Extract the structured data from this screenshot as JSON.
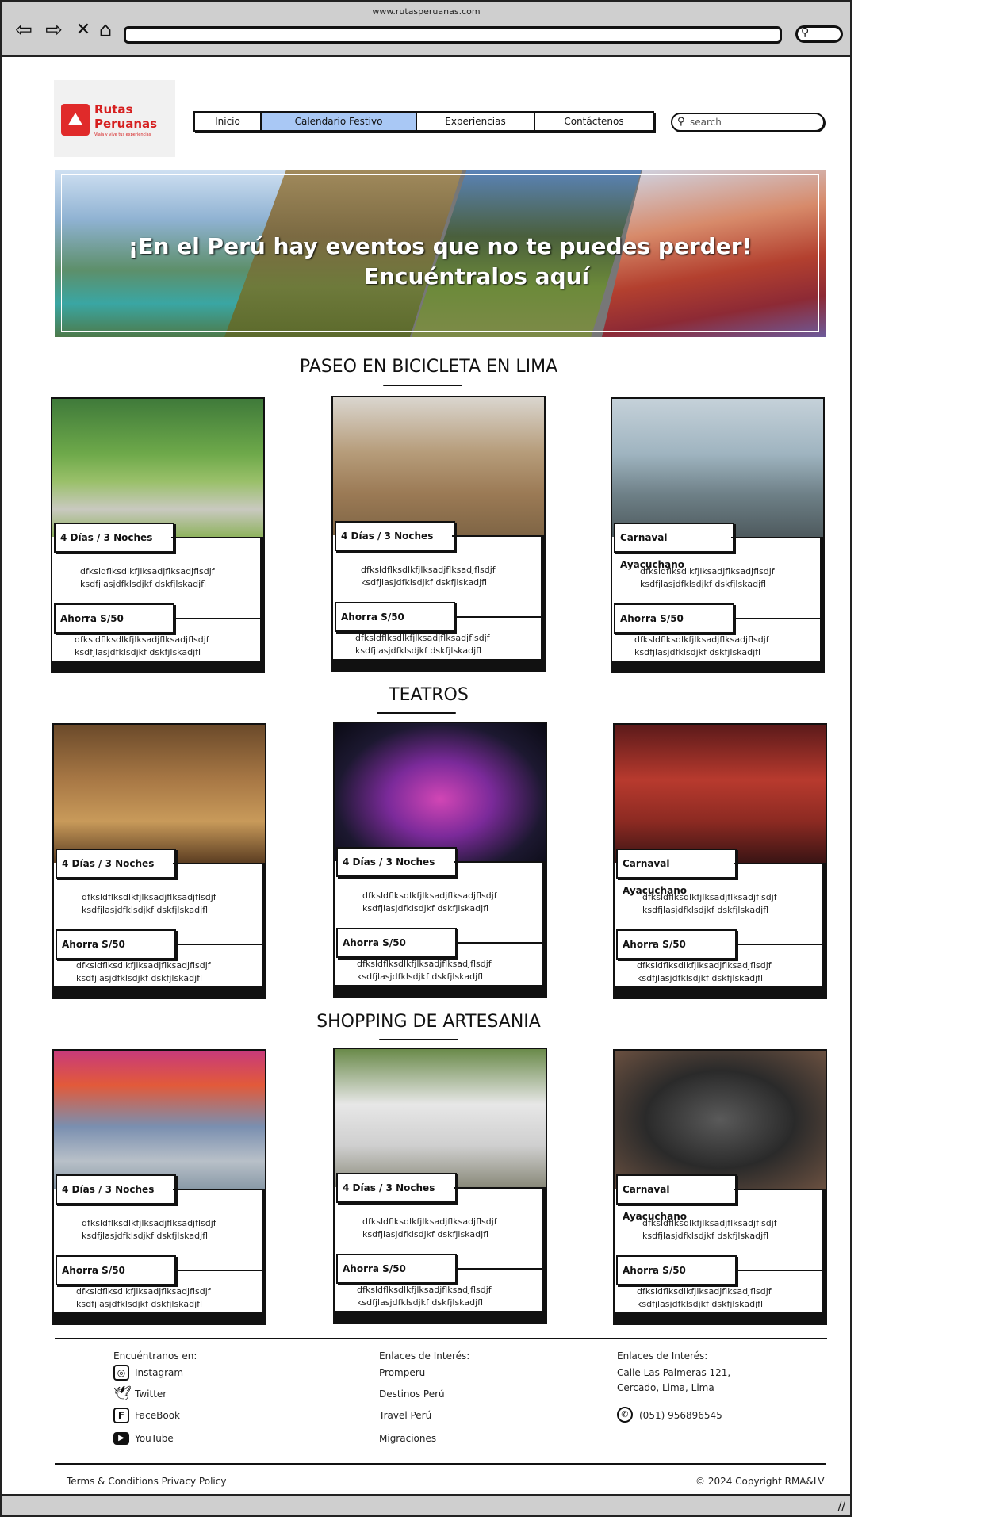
{
  "browser": {
    "url": "www.rutasperuanas.com"
  },
  "logo": {
    "name_line1": "Rutas",
    "name_line2": "Peruanas",
    "tagline": "Viaja y vive tus experiencias"
  },
  "menu": {
    "items": [
      "Inicio",
      "Calendario Festivo",
      "Experiencias",
      "Contáctenos"
    ],
    "active": "Calendario Festivo"
  },
  "search": {
    "placeholder": "search"
  },
  "banner": {
    "line1": "¡En el Perú hay eventos que no te puedes perder!",
    "line2": "Encuéntralos aquí"
  },
  "sections": [
    {
      "title": "PASEO EN BICICLETA EN LIMA",
      "cards": [
        {
          "tag": "4 Días / 3 Noches",
          "desc": "dfksldflksdlkfjlksadjflksadjflsdjf ksdfjlasjdfklsdjkf dskfjlskadjfl",
          "price": "Ahorra S/50",
          "desc2": "dfksldflksdlkfjlksadjflksadjflsdjf ksdfjlasjdfklsdjkf dskfjlskadjfl"
        },
        {
          "tag": "4 Días / 3 Noches",
          "desc": "dfksldflksdlkfjlksadjflksadjflsdjf ksdfjlasjdfklsdjkf dskfjlskadjfl",
          "price": "Ahorra S/50",
          "desc2": "dfksldflksdlkfjlksadjflksadjflsdjf ksdfjlasjdfklsdjkf dskfjlskadjfl"
        },
        {
          "tag": "Carnaval Ayacuchano",
          "desc": "dfksldflksdlkfjlksadjflksadjflsdjf ksdfjlasjdfklsdjkf dskfjlskadjfl",
          "price": "Ahorra S/50",
          "desc2": "dfksldflksdlkfjlksadjflksadjflsdjf ksdfjlasjdfklsdjkf dskfjlskadjfl"
        }
      ]
    },
    {
      "title": "TEATROS",
      "cards": [
        {
          "tag": "4 Días / 3 Noches",
          "desc": "dfksldflksdlkfjlksadjflksadjflsdjf ksdfjlasjdfklsdjkf dskfjlskadjfl",
          "price": "Ahorra S/50",
          "desc2": "dfksldflksdlkfjlksadjflksadjflsdjf ksdfjlasjdfklsdjkf dskfjlskadjfl"
        },
        {
          "tag": "4 Días / 3 Noches",
          "desc": "dfksldflksdlkfjlksadjflksadjflsdjf ksdfjlasjdfklsdjkf dskfjlskadjfl",
          "price": "Ahorra S/50",
          "desc2": "dfksldflksdlkfjlksadjflksadjflsdjf ksdfjlasjdfklsdjkf dskfjlskadjfl"
        },
        {
          "tag": "Carnaval Ayacuchano",
          "desc": "dfksldflksdlkfjlksadjflksadjflsdjf ksdfjlasjdfklsdjkf dskfjlskadjfl",
          "price": "Ahorra S/50",
          "desc2": "dfksldflksdlkfjlksadjflksadjflsdjf ksdfjlasjdfklsdjkf dskfjlskadjfl"
        }
      ]
    },
    {
      "title": "SHOPPING DE ARTESANIA",
      "cards": [
        {
          "tag": "4 Días / 3 Noches",
          "desc": "dfksldflksdlkfjlksadjflksadjflsdjf ksdfjlasjdfklsdjkf dskfjlskadjfl",
          "price": "Ahorra S/50",
          "desc2": "dfksldflksdlkfjlksadjflksadjflsdjf ksdfjlasjdfklsdjkf dskfjlskadjfl"
        },
        {
          "tag": "4 Días / 3 Noches",
          "desc": "dfksldflksdlkfjlksadjflksadjflsdjf ksdfjlasjdfklsdjkf dskfjlskadjfl",
          "price": "Ahorra S/50",
          "desc2": "dfksldflksdlkfjlksadjflksadjflsdjf ksdfjlasjdfklsdjkf dskfjlskadjfl"
        },
        {
          "tag": "Carnaval Ayacuchano",
          "desc": "dfksldflksdlkfjlksadjflksadjflsdjf ksdfjlasjdfklsdjkf dskfjlskadjfl",
          "price": "Ahorra S/50",
          "desc2": "dfksldflksdlkfjlksadjflksadjflsdjf ksdfjlasjdfklsdjkf dskfjlskadjfl"
        }
      ]
    }
  ],
  "footer": {
    "social_heading": "Encuéntranos en:",
    "social": [
      "Instagram",
      "Twitter",
      "FaceBook",
      "YouTube"
    ],
    "links_heading": "Enlaces de Interés:",
    "links": [
      "Promperu",
      "Destinos Perú",
      "Travel Perú",
      "Migraciones"
    ],
    "contact_heading": "Enlaces de Interés:",
    "address_line1": "Calle Las Palmeras 121,",
    "address_line2": "Cercado, Lima, Lima",
    "phone": "(051) 956896545",
    "terms": "Terms & Conditions Privacy Policy",
    "copyright": "© 2024 Copyright RMA&LV"
  }
}
